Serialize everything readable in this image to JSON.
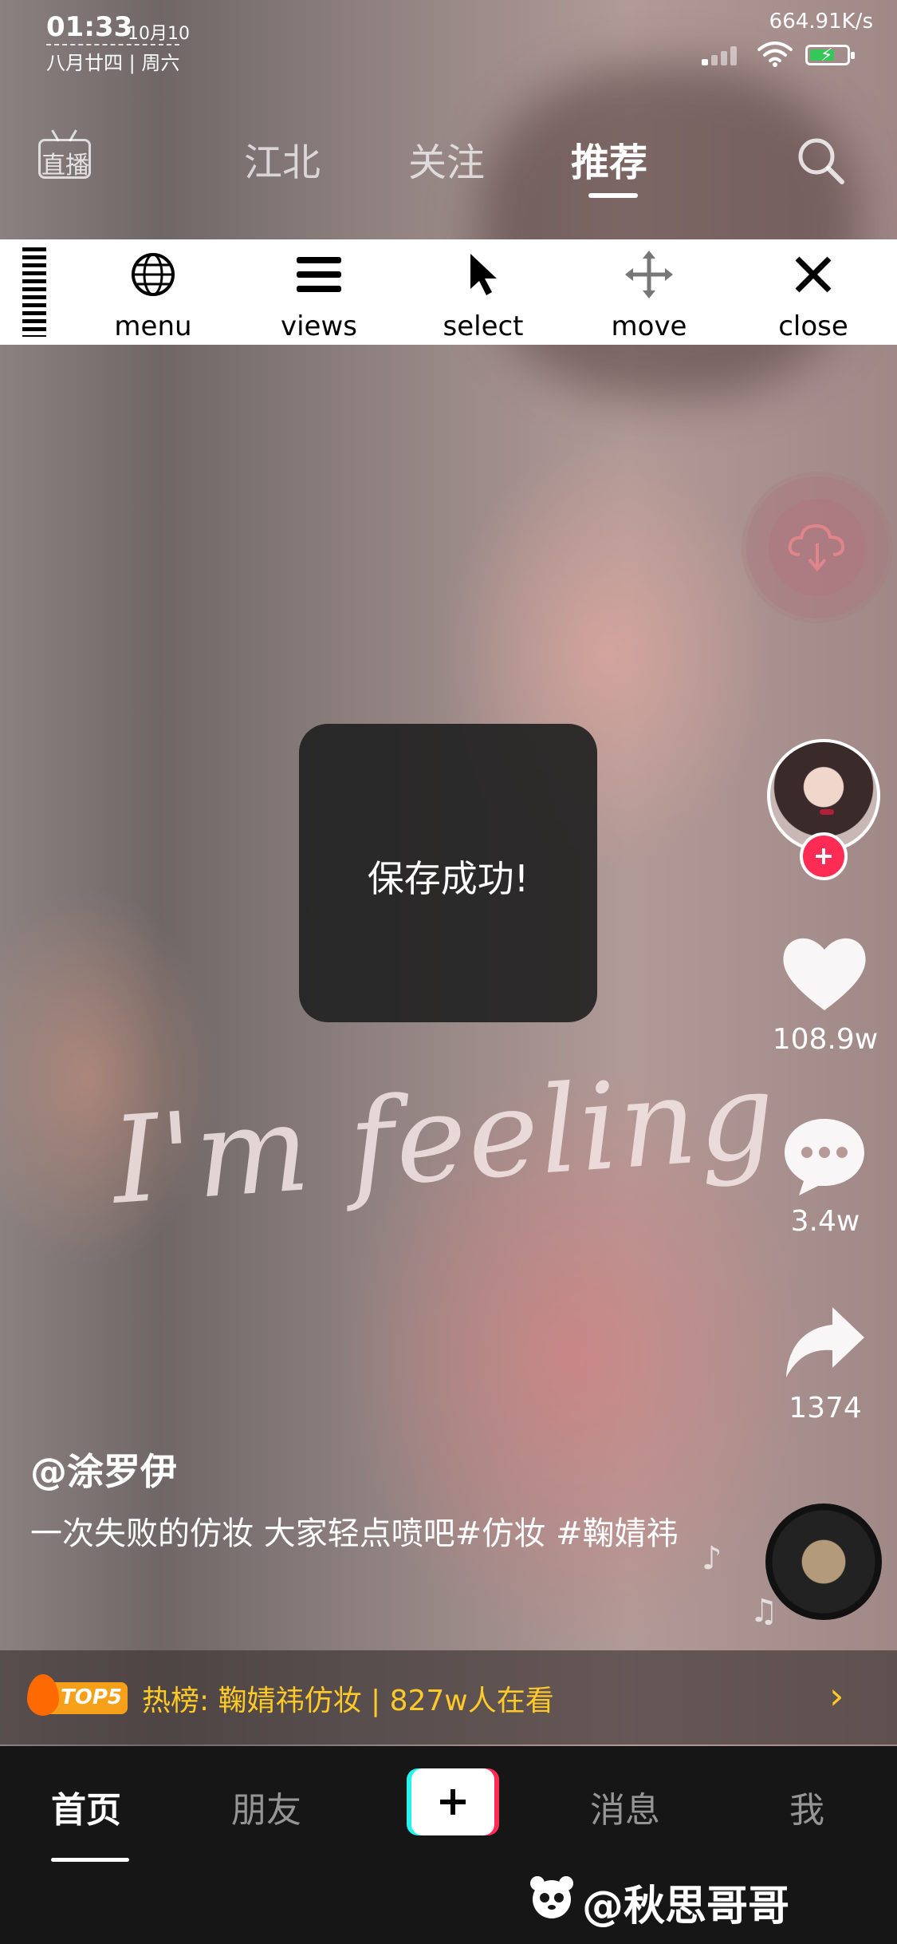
{
  "status_bar": {
    "time": "01:33",
    "date": "10月10",
    "lunar_date": "八月廿四 | 周六",
    "network_speed": "664.91K/s",
    "icons": [
      "signal-icon",
      "wifi-icon",
      "battery-charging-icon"
    ]
  },
  "top_nav": {
    "live_label": "直播",
    "tabs": [
      {
        "label": "江北",
        "active": false
      },
      {
        "label": "关注",
        "active": false
      },
      {
        "label": "推荐",
        "active": true
      }
    ],
    "search_icon": "search-icon"
  },
  "toolbar": {
    "items": [
      {
        "label": "menu",
        "icon": "globe-icon"
      },
      {
        "label": "views",
        "icon": "hamburger-icon"
      },
      {
        "label": "select",
        "icon": "cursor-icon"
      },
      {
        "label": "move",
        "icon": "move-arrows-icon"
      },
      {
        "label": "close",
        "icon": "close-icon"
      }
    ]
  },
  "download_button": {
    "icon": "cloud-download-icon"
  },
  "toast": {
    "text": "保存成功!"
  },
  "video_overlay_text": "I'm feeling",
  "right_rail": {
    "likes": "108.9w",
    "comments": "3.4w",
    "shares": "1374"
  },
  "caption": {
    "author": "@涂罗伊",
    "description": "一次失败的仿妆 大家轻点喷吧#仿妆 #鞠婧祎"
  },
  "hot_bar": {
    "badge": "TOP5",
    "text": "热榜: 鞠婧祎仿妆 | 827w人在看"
  },
  "bottom_nav": {
    "items": [
      {
        "label": "首页",
        "active": true
      },
      {
        "label": "朋友",
        "active": false
      },
      {
        "label": "消息",
        "active": false
      },
      {
        "label": "我",
        "active": false
      }
    ]
  },
  "watermark": "@秋思哥哥",
  "colors": {
    "accent_red": "#fe2c55",
    "accent_cyan": "#25f4ee",
    "hot_yellow": "#ffc927"
  }
}
